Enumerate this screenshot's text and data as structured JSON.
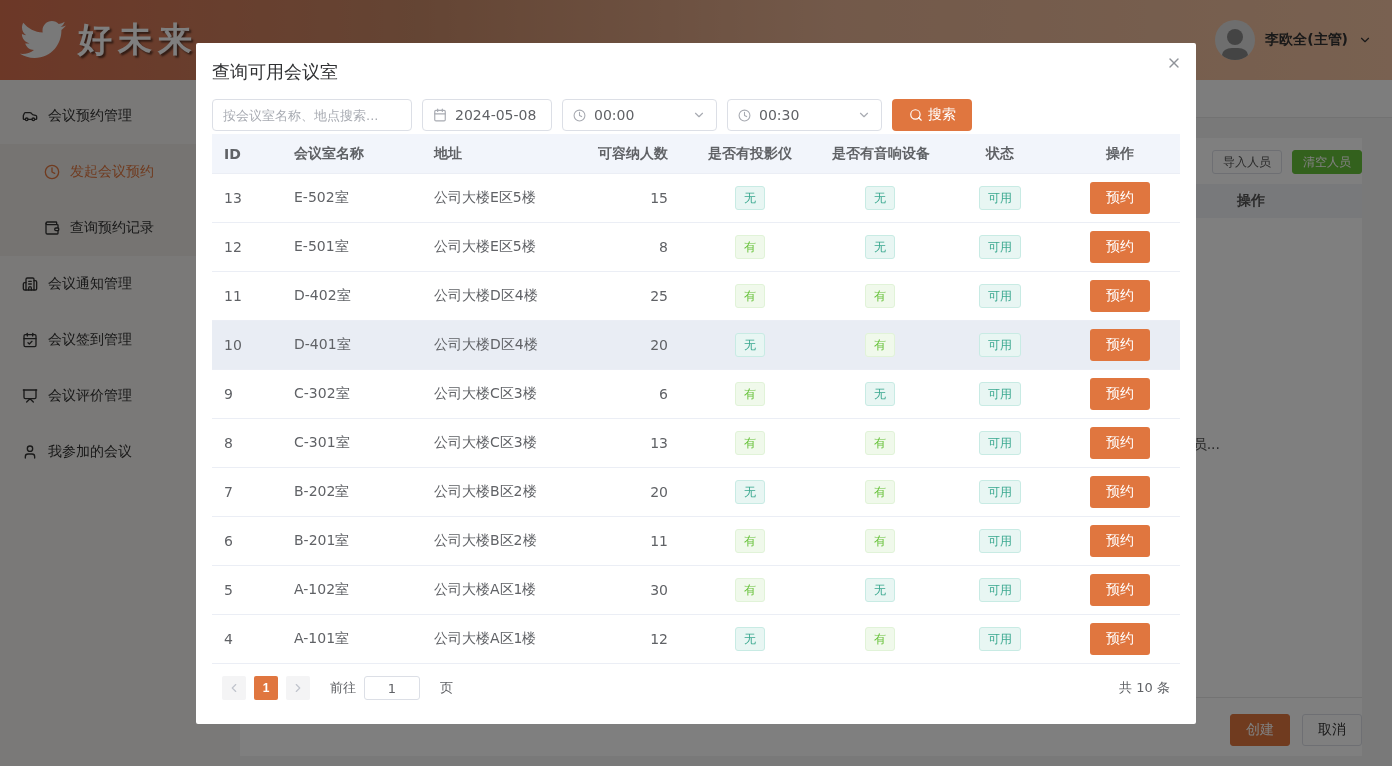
{
  "header": {
    "title": "好未来",
    "user": "李欧全(主管)"
  },
  "sidebar": {
    "items": [
      {
        "label": "会议预约管理",
        "children": [
          {
            "label": "发起会议预约",
            "selected": true
          },
          {
            "label": "查询预约记录",
            "selected": false
          }
        ]
      },
      {
        "label": "会议通知管理"
      },
      {
        "label": "会议签到管理"
      },
      {
        "label": "会议评价管理"
      },
      {
        "label": "我参加的会议"
      }
    ]
  },
  "background": {
    "buttons": [
      {
        "label": "导入人员",
        "kind": "plain"
      },
      {
        "label": "清空人员",
        "kind": "success"
      }
    ],
    "column": "操作",
    "truncated_text": "员...",
    "footer_buttons": [
      {
        "label": "创建",
        "kind": "primary"
      },
      {
        "label": "取消",
        "kind": "plain"
      }
    ]
  },
  "dialog": {
    "title": "查询可用会议室",
    "search": {
      "placeholder": "按会议室名称、地点搜索..."
    },
    "date": "2024-05-08",
    "start_time": "00:00",
    "end_time": "00:30",
    "search_button": "搜索",
    "table": {
      "columns": [
        "ID",
        "会议室名称",
        "地址",
        "可容纳人数",
        "是否有投影仪",
        "是否有音响设备",
        "状态",
        "操作"
      ],
      "rows": [
        {
          "id": "13",
          "name": "E-502室",
          "address": "公司大楼E区5楼",
          "capacity": "15",
          "projector": {
            "label": "无",
            "on": false
          },
          "audio": {
            "label": "无",
            "on": false
          },
          "status": "可用",
          "action": "预约",
          "highlighted": false
        },
        {
          "id": "12",
          "name": "E-501室",
          "address": "公司大楼E区5楼",
          "capacity": "8",
          "projector": {
            "label": "有",
            "on": true
          },
          "audio": {
            "label": "无",
            "on": false
          },
          "status": "可用",
          "action": "预约",
          "highlighted": false
        },
        {
          "id": "11",
          "name": "D-402室",
          "address": "公司大楼D区4楼",
          "capacity": "25",
          "projector": {
            "label": "有",
            "on": true
          },
          "audio": {
            "label": "有",
            "on": true
          },
          "status": "可用",
          "action": "预约",
          "highlighted": false
        },
        {
          "id": "10",
          "name": "D-401室",
          "address": "公司大楼D区4楼",
          "capacity": "20",
          "projector": {
            "label": "无",
            "on": false
          },
          "audio": {
            "label": "有",
            "on": true
          },
          "status": "可用",
          "action": "预约",
          "highlighted": true
        },
        {
          "id": "9",
          "name": "C-302室",
          "address": "公司大楼C区3楼",
          "capacity": "6",
          "projector": {
            "label": "有",
            "on": true
          },
          "audio": {
            "label": "无",
            "on": false
          },
          "status": "可用",
          "action": "预约",
          "highlighted": false
        },
        {
          "id": "8",
          "name": "C-301室",
          "address": "公司大楼C区3楼",
          "capacity": "13",
          "projector": {
            "label": "有",
            "on": true
          },
          "audio": {
            "label": "有",
            "on": true
          },
          "status": "可用",
          "action": "预约",
          "highlighted": false
        },
        {
          "id": "7",
          "name": "B-202室",
          "address": "公司大楼B区2楼",
          "capacity": "20",
          "projector": {
            "label": "无",
            "on": false
          },
          "audio": {
            "label": "有",
            "on": true
          },
          "status": "可用",
          "action": "预约",
          "highlighted": false
        },
        {
          "id": "6",
          "name": "B-201室",
          "address": "公司大楼B区2楼",
          "capacity": "11",
          "projector": {
            "label": "有",
            "on": true
          },
          "audio": {
            "label": "有",
            "on": true
          },
          "status": "可用",
          "action": "预约",
          "highlighted": false
        },
        {
          "id": "5",
          "name": "A-102室",
          "address": "公司大楼A区1楼",
          "capacity": "30",
          "projector": {
            "label": "有",
            "on": true
          },
          "audio": {
            "label": "无",
            "on": false
          },
          "status": "可用",
          "action": "预约",
          "highlighted": false
        },
        {
          "id": "4",
          "name": "A-101室",
          "address": "公司大楼A区1楼",
          "capacity": "12",
          "projector": {
            "label": "无",
            "on": false
          },
          "audio": {
            "label": "有",
            "on": true
          },
          "status": "可用",
          "action": "预约",
          "highlighted": false
        }
      ]
    },
    "pagination": {
      "pages": [
        {
          "label": "1",
          "selected": true
        }
      ],
      "goto_label": "前往",
      "goto_value": "1",
      "page_unit": "页",
      "total": "共 10 条"
    }
  }
}
